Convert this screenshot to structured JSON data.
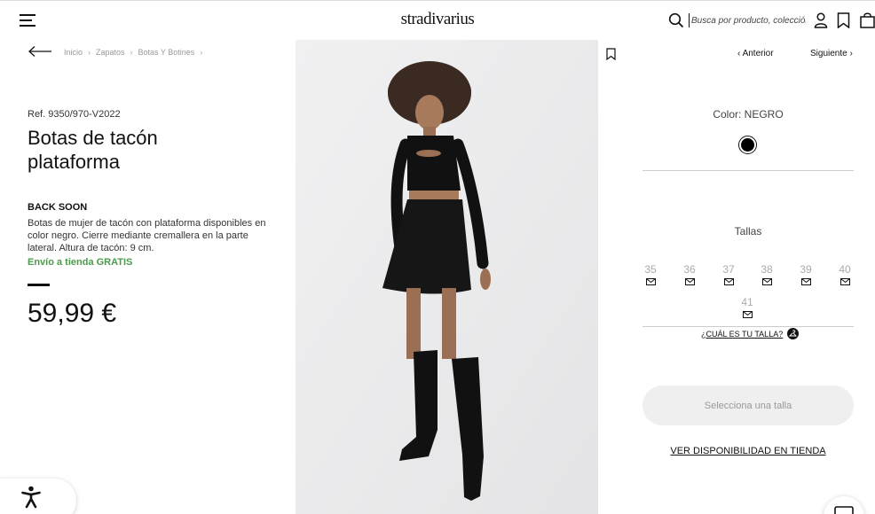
{
  "header": {
    "logo": "stradivarius",
    "search_placeholder": "Busca por producto, colección..."
  },
  "breadcrumb": [
    "Inicio",
    "Zapatos",
    "Botas Y Botines"
  ],
  "product": {
    "ref": "Ref. 9350/970-V2022",
    "title": "Botas de tacón plataforma",
    "status": "BACK SOON",
    "description": "Botas de mujer de tacón con plataforma disponibles en color negro. Cierre mediante cremallera en la parte lateral. Altura de tacón: 9 cm.",
    "shipping": "Envío a tienda GRATIS",
    "price": "59,99 €"
  },
  "nav": {
    "prev": "Anterior",
    "next": "Siguiente"
  },
  "color": {
    "label": "Color: NEGRO",
    "swatch": "#000000"
  },
  "sizes": {
    "label": "Tallas",
    "items": [
      "35",
      "36",
      "37",
      "38",
      "39",
      "40",
      "41"
    ],
    "guide": "¿CUÁL ES TU TALLA?"
  },
  "actions": {
    "select_size": "Selecciona una talla",
    "store_availability": "VER DISPONIBILIDAD EN TIENDA"
  },
  "colors": {
    "accent_green": "#4c9a4c",
    "button_bg": "#efefef"
  }
}
